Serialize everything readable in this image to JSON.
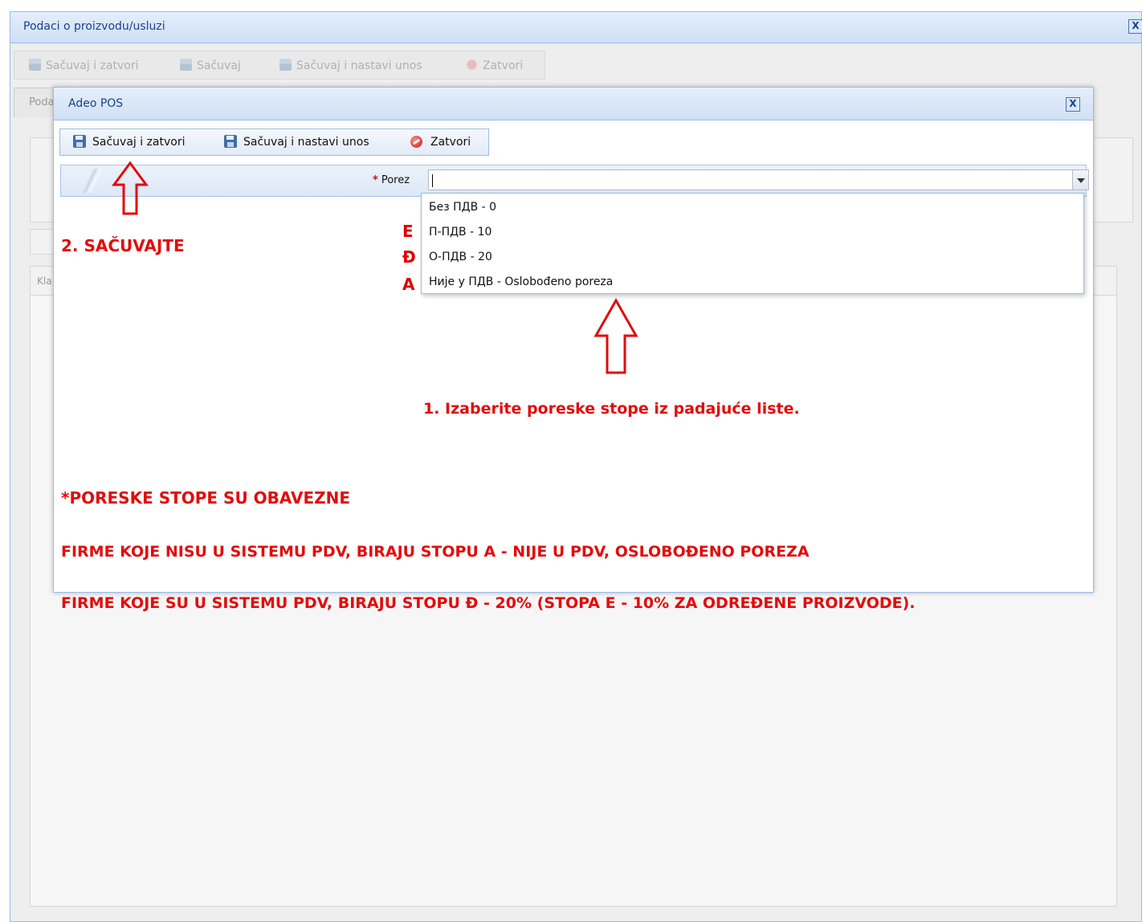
{
  "background_window": {
    "title": "Podaci o proizvodu/usluzi",
    "close_label": "X",
    "toolbar": {
      "save_close": "Sačuvaj i zatvori",
      "save": "Sačuvaj",
      "save_continue": "Sačuvaj i nastavi unos",
      "close": "Zatvori"
    },
    "tab_label": "Poda",
    "column_label": "Kla"
  },
  "dialog": {
    "title": "Adeo POS",
    "close_label": "X",
    "toolbar": {
      "save_close": "Sačuvaj i zatvori",
      "save_continue": "Sačuvaj i nastavi unos",
      "close": "Zatvori"
    },
    "field": {
      "required_mark": "*",
      "label": "Porez",
      "value": ""
    },
    "dropdown_options": [
      "Без ПДВ - 0",
      "П-ПДВ - 10",
      "О-ПДВ - 20",
      "Није у ПДВ - Oslobođeno poreza"
    ]
  },
  "rate_letters": [
    "E",
    "Đ",
    "A"
  ],
  "annotations": {
    "step2": "2. SAČUVAJTE",
    "step1": "1. Izaberite poreske stope iz padajuće liste.",
    "note_required": "*PORESKE STOPE SU OBAVEZNE",
    "note_non_vat": "FIRME KOJE NISU U SISTEMU PDV, BIRAJU STOPU A - NIJE U PDV, OSLOBOĐENO POREZA",
    "note_vat": "FIRME KOJE SU U SISTEMU PDV, BIRAJU STOPU Đ - 20% (STOPA E - 10% ZA ODREĐENE PROIZVODE)."
  },
  "colors": {
    "annotation_red": "#e30b0b",
    "header_blue": "#15428b",
    "border_blue": "#99bbe8"
  }
}
